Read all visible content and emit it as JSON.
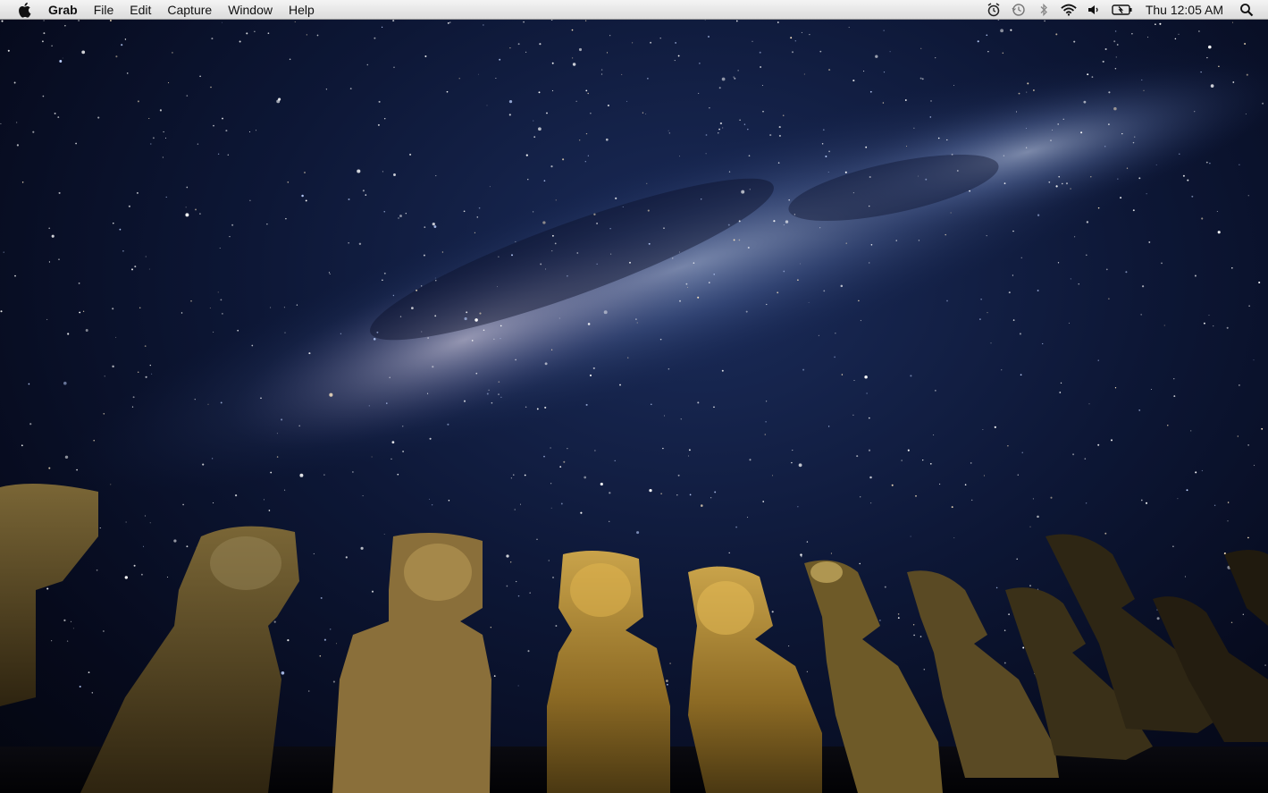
{
  "menubar": {
    "app_name": "Grab",
    "menus": [
      {
        "label": "File"
      },
      {
        "label": "Edit"
      },
      {
        "label": "Capture"
      },
      {
        "label": "Window"
      },
      {
        "label": "Help"
      }
    ],
    "status_icons": [
      "alarm-clock-icon",
      "time-machine-icon",
      "bluetooth-icon",
      "wifi-icon",
      "volume-icon",
      "battery-icon"
    ],
    "clock": "Thu 12:05 AM",
    "spotlight_icon": "spotlight-search-icon"
  },
  "colors": {
    "menubar_bg": "#e6e6e6",
    "sky_dark": "#060a1c",
    "sky_mid": "#1b2c5a",
    "milky_way": "#9fb4d8",
    "stone": "#b08a2e"
  }
}
